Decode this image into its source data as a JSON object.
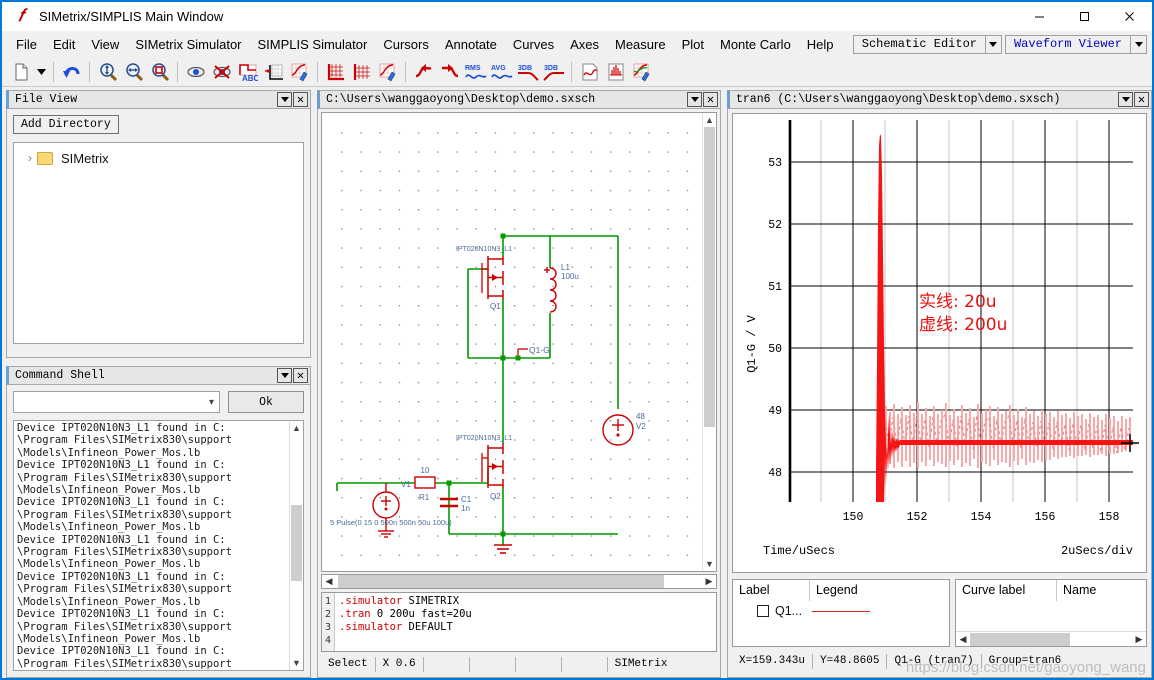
{
  "window": {
    "title": "SIMetrix/SIMPLIS Main Window",
    "logo": "simetrix-logo-icon",
    "minimize": "minimize-icon",
    "maximize": "maximize-icon",
    "close": "close-icon"
  },
  "menubar": {
    "items": [
      {
        "label": "File"
      },
      {
        "label": "Edit"
      },
      {
        "label": "View"
      },
      {
        "label": "SIMetrix Simulator"
      },
      {
        "label": "SIMPLIS Simulator"
      },
      {
        "label": "Cursors"
      },
      {
        "label": "Annotate"
      },
      {
        "label": "Curves"
      },
      {
        "label": "Axes"
      },
      {
        "label": "Measure"
      },
      {
        "label": "Plot"
      },
      {
        "label": "Monte Carlo"
      },
      {
        "label": "Help"
      }
    ],
    "mode_selects": [
      {
        "label": "Schematic Editor",
        "color": "#000000"
      },
      {
        "label": "Waveform Viewer",
        "color": "#0000c0"
      }
    ]
  },
  "toolbar": {
    "buttons": [
      {
        "name": "new-document-icon"
      },
      {
        "name": "new-document-dropdown-icon"
      },
      {
        "name": "undo-icon"
      },
      {
        "name": "zoom-vertical-icon"
      },
      {
        "name": "zoom-horizontal-icon"
      },
      {
        "name": "zoom-box-icon"
      },
      {
        "name": "show-curve-icon"
      },
      {
        "name": "hide-curve-icon"
      },
      {
        "name": "add-text-icon"
      },
      {
        "name": "add-axis-icon"
      },
      {
        "name": "edit-graph-icon"
      },
      {
        "name": "grid-axes-icon"
      },
      {
        "name": "grid-icon"
      },
      {
        "name": "graph-style-icon"
      },
      {
        "name": "rising-edge-icon"
      },
      {
        "name": "falling-edge-icon"
      },
      {
        "name": "rms-icon"
      },
      {
        "name": "avg-icon"
      },
      {
        "name": "3db-falling-icon"
      },
      {
        "name": "3db-rising-icon"
      },
      {
        "name": "new-graph-sheet-icon"
      },
      {
        "name": "fft-icon"
      },
      {
        "name": "open-graph-icon"
      }
    ]
  },
  "file_view": {
    "title": "File View",
    "add_directory_label": "Add Directory",
    "tree": [
      {
        "label": "SIMetrix",
        "icon": "folder-icon",
        "expand": "›"
      }
    ]
  },
  "command_shell": {
    "title": "Command Shell",
    "input_value": "",
    "input_placeholder": "",
    "ok_label": "Ok",
    "log": "Device IPT020N10N3_L1 found in C:\n\\Program Files\\SIMetrix830\\support\n\\Models\\Infineon_Power_Mos.lb\nDevice IPT020N10N3_L1 found in C:\n\\Program Files\\SIMetrix830\\support\n\\Models\\Infineon_Power_Mos.lb\nDevice IPT020N10N3_L1 found in C:\n\\Program Files\\SIMetrix830\\support\n\\Models\\Infineon_Power_Mos.lb\nDevice IPT020N10N3_L1 found in C:\n\\Program Files\\SIMetrix830\\support\n\\Models\\Infineon_Power_Mos.lb\nDevice IPT020N10N3_L1 found in C:\n\\Program Files\\SIMetrix830\\support\n\\Models\\Infineon_Power_Mos.lb\nDevice IPT020N10N3_L1 found in C:\n\\Program Files\\SIMetrix830\\support\n\\Models\\Infineon_Power_Mos.lb\nDevice IPT020N10N3_L1 found in C:\n\\Program Files\\SIMetrix830\\support\n\\Models\\Infineon_Power_Mos.lb"
  },
  "schematic": {
    "title": "C:\\Users\\wanggaoyong\\Desktop\\demo.sxsch",
    "components": {
      "q1_model": "IPT020N10N3_L1",
      "q1_ref": "Q1",
      "q2_model": "IPT020N10N3_L1",
      "q2_ref": "Q2",
      "l1_ref": "L1",
      "l1_value": "100u",
      "r1_value": "10",
      "r1_ref": "R1",
      "c1_ref": "C1",
      "c1_value": "1n",
      "v1_ref": "V1",
      "v1_value": "5 Pulse(0 15 0 500n 500n 50u 100u)",
      "v2_ref": "V2",
      "v2_value": "48",
      "net_label": "Q1-G"
    },
    "code": {
      "lines": [
        {
          "no": "1",
          "keyword": ".simulator",
          "rest": " SIMETRIX"
        },
        {
          "no": "2",
          "keyword": ".tran",
          "rest": " 0 200u fast=20u"
        },
        {
          "no": "3",
          "keyword": ".simulator",
          "rest": " DEFAULT"
        },
        {
          "no": "4",
          "keyword": "",
          "rest": ""
        }
      ]
    },
    "status": [
      {
        "text": "Select"
      },
      {
        "text": "X 0.6"
      },
      {
        "text": ""
      },
      {
        "text": ""
      },
      {
        "text": ""
      },
      {
        "text": ""
      },
      {
        "text": "SIMetrix"
      }
    ]
  },
  "waveform": {
    "title": "tran6 (C:\\Users\\wanggaoyong\\Desktop\\demo.sxsch)",
    "annotation": {
      "line1": "实线: 20u",
      "line2": "虚线: 200u",
      "color": "#e81010"
    },
    "legend_left": {
      "col1": "Label",
      "col2": "Legend",
      "rows": [
        {
          "label": "Q1...",
          "color": "#e02020",
          "checked": false
        }
      ]
    },
    "legend_right": {
      "col1": "Curve label",
      "col2": "Name",
      "rows": []
    },
    "status": [
      {
        "text": "X=159.343u"
      },
      {
        "text": "Y=48.8605"
      },
      {
        "text": "Q1-G (tran7)"
      },
      {
        "text": "Group=tran6"
      }
    ],
    "watermark": "https://blog.csdn.net/gaoyong_wang"
  },
  "chart_data": {
    "type": "line",
    "title": "",
    "xlabel": "Time/uSecs",
    "ylabel": "Q1-G / V",
    "xlim": [
      148.8,
      159.6
    ],
    "ylim": [
      47.4,
      53.6
    ],
    "xticks": [
      150,
      152,
      154,
      156,
      158
    ],
    "yticks": [
      48,
      49,
      50,
      51,
      52,
      53
    ],
    "x_per_div": "2uSecs/div",
    "grid": true,
    "series": [
      {
        "name": "Q1-G (tran7) solid 20u",
        "color": "#f01010",
        "style": "solid",
        "description": "Sharp spike at t=151.1us rising to 53.4V then ringing down, settling at ~48.65V"
      },
      {
        "name": "Q1-G dashed 200u",
        "color": "#f5a0a0",
        "style": "dashed",
        "description": "Coarse 200u timestep version showing large aliasing oscillation around 48.6V decaying slowly to 159.6us"
      }
    ],
    "cursor": {
      "x": 159.343,
      "y": 48.8605,
      "label": "X=159.343u  Y=48.8605"
    }
  }
}
